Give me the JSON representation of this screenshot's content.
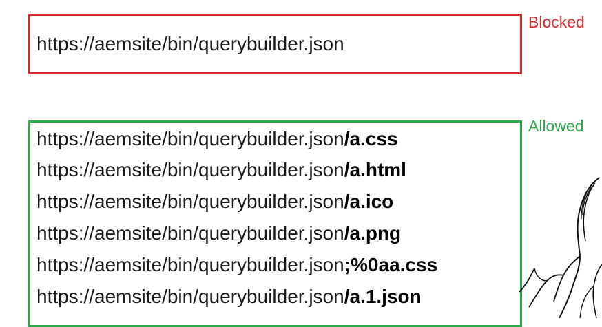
{
  "colors": {
    "blocked": "#d62b2b",
    "allowed": "#2aa84a"
  },
  "blocked": {
    "label": "Blocked",
    "url": "https://aemsite/bin/querybuilder.json"
  },
  "allowed": {
    "label": "Allowed",
    "items": [
      {
        "base": "https://aemsite/bin/querybuilder.json",
        "suffix": "/a.css"
      },
      {
        "base": "https://aemsite/bin/querybuilder.json",
        "suffix": "/a.html"
      },
      {
        "base": "https://aemsite/bin/querybuilder.json",
        "suffix": "/a.ico"
      },
      {
        "base": "https://aemsite/bin/querybuilder.json",
        "suffix": "/a.png"
      },
      {
        "base": "https://aemsite/bin/querybuilder.json",
        "suffix": ";%0aa.css"
      },
      {
        "base": "https://aemsite/bin/querybuilder.json",
        "suffix": "/a.1.json"
      }
    ]
  },
  "decoration": {
    "icon": "facepalm-icon"
  }
}
